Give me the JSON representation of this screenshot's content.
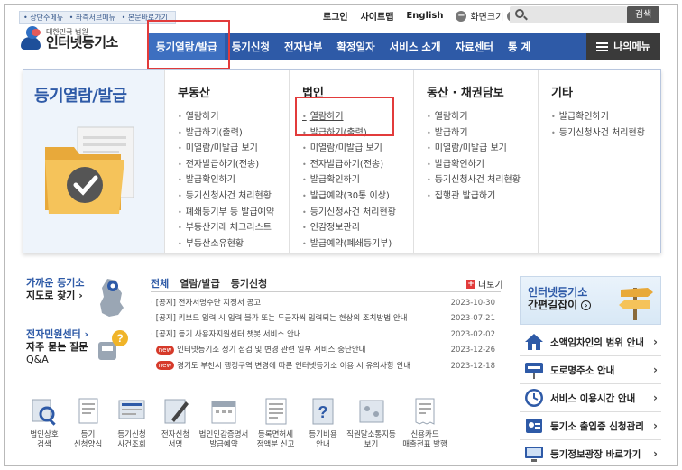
{
  "skip_links": [
    "• 상단주메뉴",
    "• 좌측서브메뉴",
    "• 본문바로가기"
  ],
  "util": {
    "login": "로그인",
    "sitemap": "사이트맵",
    "english": "English",
    "font_size": "화면크기",
    "minus": "−",
    "plus": "+"
  },
  "search": {
    "button": "검색",
    "placeholder": ""
  },
  "logo": {
    "sub": "대한민국 법원",
    "main": "인터넷등기소"
  },
  "nav": {
    "items": [
      "등기열람/발급",
      "등기신청",
      "전자납부",
      "확정일자",
      "서비스 소개",
      "자료센터",
      "통 계"
    ],
    "my_menu": "나의메뉴"
  },
  "mega": {
    "title": "등기열람/발급",
    "columns": [
      {
        "head": "부동산",
        "items": [
          "열람하기",
          "발급하기(출력)",
          "미열람/미발급 보기",
          "전자발급하기(전송)",
          "발급확인하기",
          "등기신청사건 처리현황",
          "폐쇄등기부 등 발급예약",
          "부동산거래 체크리스트",
          "부동산소유현황"
        ]
      },
      {
        "head": "법인",
        "items": [
          "열람하기",
          "발급하기(출력)",
          "미열람/미발급 보기",
          "전자발급하기(전송)",
          "발급확인하기",
          "발급예약(30통 이상)",
          "등기신청사건 처리현황",
          "인감정보관리",
          "발급예약(폐쇄등기부)"
        ]
      },
      {
        "head": "동산 · 채권담보",
        "items": [
          "열람하기",
          "발급하기",
          "미열람/미발급 보기",
          "발급확인하기",
          "등기신청사건 처리현황",
          "집행관 발급하기"
        ]
      },
      {
        "head": "기타",
        "items": [
          "발급확인하기",
          "등기신청사건 처리현황"
        ]
      }
    ]
  },
  "promo": {
    "map_l1": "가까운 등기소",
    "map_l2": "지도로 찾기 ›",
    "call_l1": "전자민원센터 ›",
    "call_l2": "자주 묻는 질문",
    "call_l3": "Q&A"
  },
  "notice": {
    "tabs": [
      "전체",
      "열람/발급",
      "등기신청"
    ],
    "more": "더보기",
    "items": [
      {
        "new": false,
        "text": "[공지] 전자서명수단 지정서 공고",
        "date": "2023-10-30"
      },
      {
        "new": false,
        "text": "[공지] 키보드 입력 시 입력 불가 또는 두글자씩 입력되는 현상의 조치방법 안내",
        "date": "2023-07-21"
      },
      {
        "new": false,
        "text": "[공지] 등기 사용자지원센터 챗봇 서비스 안내",
        "date": "2023-02-02"
      },
      {
        "new": true,
        "badge": "new",
        "text": "인터넷등기소 정기 점검 및 변경 관련 일부 서비스 중단안내",
        "date": "2023-12-26"
      },
      {
        "new": true,
        "badge": "new",
        "text": "경기도 부천시 행정구역 변경에 따른 인터넷등기소 이용 시 유의사항 안내",
        "date": "2023-12-18"
      }
    ]
  },
  "quick": [
    {
      "l1": "법인상호",
      "l2": "검색"
    },
    {
      "l1": "등기",
      "l2": "신청양식"
    },
    {
      "l1": "등기신청",
      "l2": "사건조회"
    },
    {
      "l1": "전자신청",
      "l2": "서명"
    },
    {
      "l1": "법인인감증명서",
      "l2": "발급예약"
    },
    {
      "l1": "등록면허세",
      "l2": "정액분 신고"
    },
    {
      "l1": "등기비용",
      "l2": "안내"
    },
    {
      "l1": "직권말소통지등",
      "l2": "보기"
    },
    {
      "l1": "신용카드",
      "l2": "매출전표 발행"
    }
  ],
  "guide": {
    "l1": "인터넷등기소",
    "l2": "간편길잡이",
    "arrow": "›"
  },
  "services": [
    "소액임차인의 범위 안내",
    "도로명주소 안내",
    "서비스 이용시간 안내",
    "등기소 출입증 신청관리",
    "등기정보광장 바로가기"
  ],
  "colors": {
    "nav": "#2e5aa7",
    "highlight": "#e23b3b",
    "my_menu": "#3a3a3a"
  }
}
